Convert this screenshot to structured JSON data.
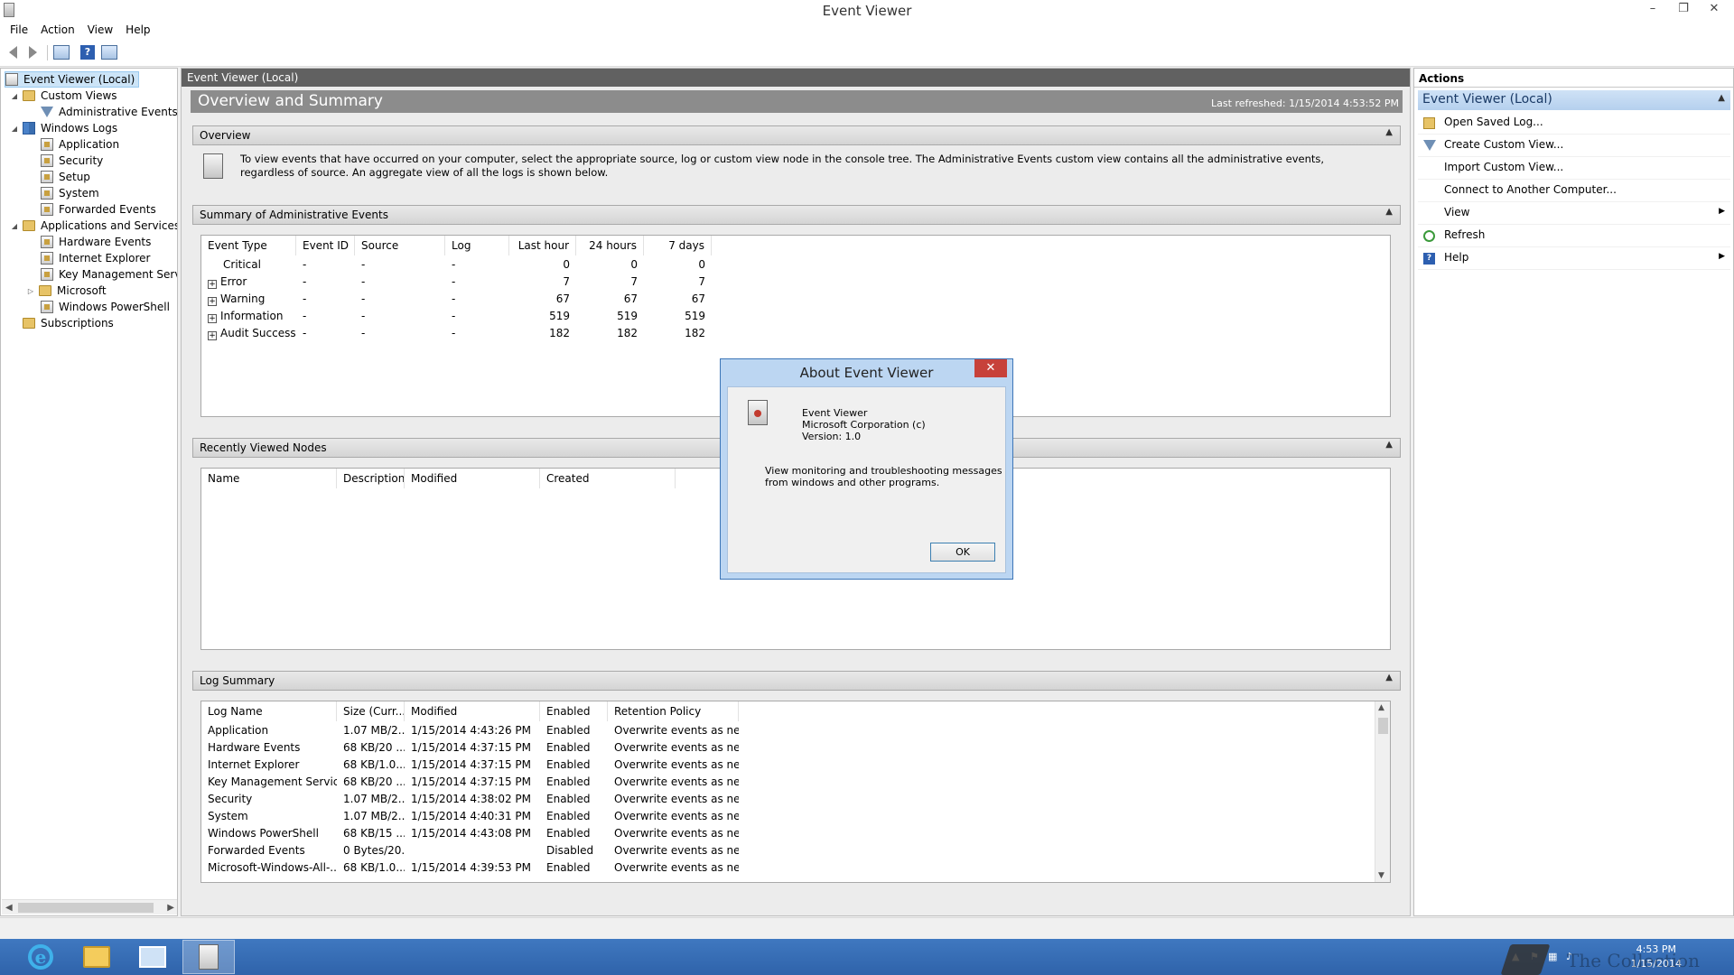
{
  "window": {
    "title": "Event Viewer",
    "controls": {
      "minimize": "–",
      "restore": "❐",
      "close": "✕"
    }
  },
  "menu": [
    "File",
    "Action",
    "View",
    "Help"
  ],
  "tree": [
    {
      "label": "Event Viewer (Local)",
      "icon": "root-icon",
      "selected": true
    },
    {
      "label": "Custom Views",
      "icon": "folder-icon"
    },
    {
      "label": "Administrative Events",
      "icon": "funnel-icon"
    },
    {
      "label": "Windows Logs",
      "icon": "windows-logs-icon"
    },
    {
      "label": "Application",
      "icon": "log-icon"
    },
    {
      "label": "Security",
      "icon": "log-icon"
    },
    {
      "label": "Setup",
      "icon": "log-icon"
    },
    {
      "label": "System",
      "icon": "log-icon"
    },
    {
      "label": "Forwarded Events",
      "icon": "log-icon"
    },
    {
      "label": "Applications and Services Lo",
      "icon": "folder-icon"
    },
    {
      "label": "Hardware Events",
      "icon": "log-icon"
    },
    {
      "label": "Internet Explorer",
      "icon": "log-icon"
    },
    {
      "label": "Key Management Service",
      "icon": "log-icon"
    },
    {
      "label": "Microsoft",
      "icon": "folder-icon"
    },
    {
      "label": "Windows PowerShell",
      "icon": "log-icon"
    },
    {
      "label": "Subscriptions",
      "icon": "folder-icon"
    }
  ],
  "center": {
    "header": "Event Viewer (Local)",
    "banner_title": "Overview and Summary",
    "last_refreshed": "Last refreshed: 1/15/2014 4:53:52 PM",
    "overview": {
      "title": "Overview",
      "text": "To view events that have occurred on your computer, select the appropriate source, log or custom view node in the console tree. The Administrative Events custom view contains all the administrative events, regardless of source. An aggregate view of all the logs is shown below."
    },
    "summary": {
      "title": "Summary of Administrative Events",
      "columns": [
        "Event Type",
        "Event ID",
        "Source",
        "Log",
        "Last hour",
        "24 hours",
        "7 days"
      ],
      "rows": [
        [
          "Critical",
          "-",
          "-",
          "-",
          "0",
          "0",
          "0"
        ],
        [
          "Error",
          "-",
          "-",
          "-",
          "7",
          "7",
          "7"
        ],
        [
          "Warning",
          "-",
          "-",
          "-",
          "67",
          "67",
          "67"
        ],
        [
          "Information",
          "-",
          "-",
          "-",
          "519",
          "519",
          "519"
        ],
        [
          "Audit Success",
          "-",
          "-",
          "-",
          "182",
          "182",
          "182"
        ]
      ]
    },
    "recent": {
      "title": "Recently Viewed Nodes",
      "columns": [
        "Name",
        "Description",
        "Modified",
        "Created"
      ]
    },
    "log_summary": {
      "title": "Log Summary",
      "columns": [
        "Log Name",
        "Size (Curr...",
        "Modified",
        "Enabled",
        "Retention Policy"
      ],
      "rows": [
        [
          "Application",
          "1.07 MB/2...",
          "1/15/2014 4:43:26 PM",
          "Enabled",
          "Overwrite events as nec..."
        ],
        [
          "Hardware Events",
          "68 KB/20 ...",
          "1/15/2014 4:37:15 PM",
          "Enabled",
          "Overwrite events as nec..."
        ],
        [
          "Internet Explorer",
          "68 KB/1.0...",
          "1/15/2014 4:37:15 PM",
          "Enabled",
          "Overwrite events as nec..."
        ],
        [
          "Key Management Service",
          "68 KB/20 ...",
          "1/15/2014 4:37:15 PM",
          "Enabled",
          "Overwrite events as nec..."
        ],
        [
          "Security",
          "1.07 MB/2...",
          "1/15/2014 4:38:02 PM",
          "Enabled",
          "Overwrite events as nec..."
        ],
        [
          "System",
          "1.07 MB/2...",
          "1/15/2014 4:40:31 PM",
          "Enabled",
          "Overwrite events as nec..."
        ],
        [
          "Windows PowerShell",
          "68 KB/15 ...",
          "1/15/2014 4:43:08 PM",
          "Enabled",
          "Overwrite events as nec..."
        ],
        [
          "Forwarded Events",
          "0 Bytes/20...",
          "",
          "Disabled",
          "Overwrite events as nec..."
        ],
        [
          "Microsoft-Windows-All-...",
          "68 KB/1.0...",
          "1/15/2014 4:39:53 PM",
          "Enabled",
          "Overwrite events as nec..."
        ]
      ]
    }
  },
  "actions": {
    "title": "Actions",
    "section": "Event Viewer (Local)",
    "items": [
      {
        "label": "Open Saved Log...",
        "icon": "open-log-icon"
      },
      {
        "label": "Create Custom View...",
        "icon": "funnel-icon"
      },
      {
        "label": "Import Custom View...",
        "icon": ""
      },
      {
        "label": "Connect to Another Computer...",
        "icon": ""
      },
      {
        "label": "View",
        "icon": "",
        "submenu": true
      },
      {
        "label": "Refresh",
        "icon": "refresh-icon"
      },
      {
        "label": "Help",
        "icon": "help-icon",
        "submenu": true
      }
    ]
  },
  "dialog": {
    "title": "About Event Viewer",
    "close": "✕",
    "product": "Event Viewer",
    "company": "Microsoft Corporation (c)",
    "version": "Version: 1.0",
    "description_1": "View monitoring and troubleshooting messages",
    "description_2": "from windows and other programs.",
    "ok": "OK"
  },
  "taskbar": {
    "time": "4:53 PM",
    "date": "1/15/2014",
    "watermark": "The Collection Book"
  },
  "colors": {
    "center_header": "#616161",
    "banner": "#8c8c8c",
    "actions_section": "#b5d0ee",
    "taskbar": "#2f63aa",
    "dialog_frame": "#bcd6f2",
    "dialog_close": "#c7413a"
  }
}
